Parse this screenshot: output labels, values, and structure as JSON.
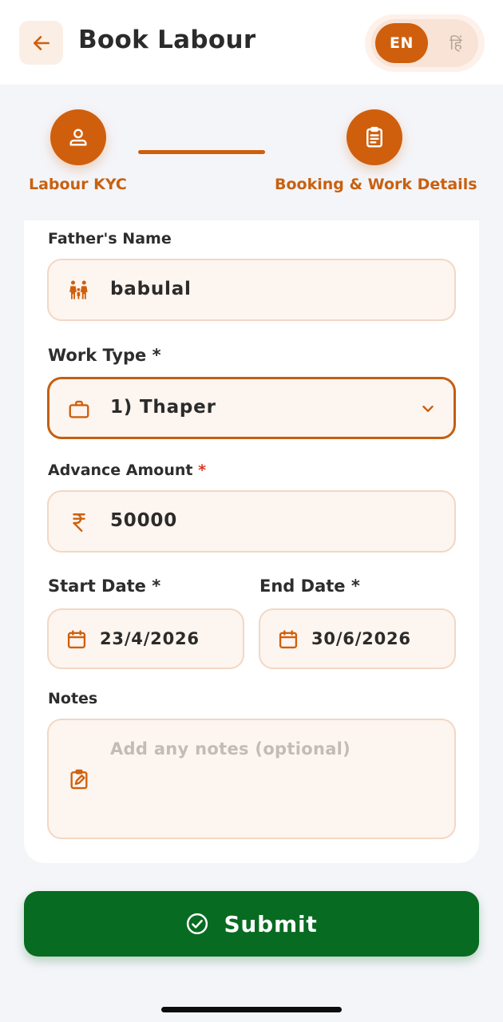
{
  "header": {
    "title": "Book Labour",
    "lang_en": "EN",
    "lang_hi": "हिं"
  },
  "stepper": {
    "step1_label": "Labour KYC",
    "step2_label": "Booking & Work Details"
  },
  "form": {
    "fathers_name": {
      "label": "Father's Name",
      "value": "babulal"
    },
    "work_type": {
      "label": "Work Type *",
      "value": "1) Thaper"
    },
    "advance_amount": {
      "label": "Advance Amount",
      "required_mark": "*",
      "value": "50000"
    },
    "start_date": {
      "label": "Start Date *",
      "value": "23/4/2026"
    },
    "end_date": {
      "label": "End Date *",
      "value": "30/6/2026"
    },
    "notes": {
      "label": "Notes",
      "placeholder": "Add any notes (optional)"
    }
  },
  "submit": {
    "label": "Submit"
  },
  "colors": {
    "accent": "#cf5f0d",
    "submit": "#076b21",
    "field_bg": "#fdf5ef"
  },
  "icons": {
    "back": "arrow-left-icon",
    "step1": "person-icon",
    "step2": "clipboard-icon",
    "fathers_name": "family-icon",
    "work_type": "briefcase-icon",
    "dropdown": "chevron-down-icon",
    "amount": "rupee-icon",
    "date": "calendar-icon",
    "notes": "edit-note-icon",
    "submit": "check-circle-icon"
  }
}
